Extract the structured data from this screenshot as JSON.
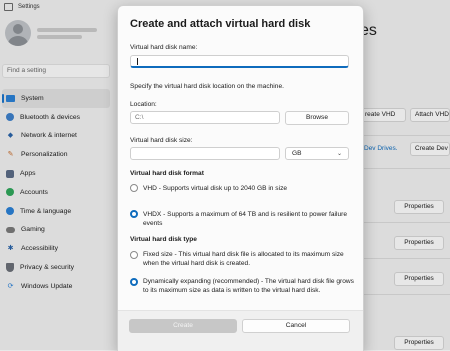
{
  "window": {
    "title": "Settings"
  },
  "sidebar": {
    "search_placeholder": "Find a setting",
    "items": [
      {
        "label": "System",
        "icon": "system-icon",
        "active": true
      },
      {
        "label": "Bluetooth & devices",
        "icon": "bluetooth-icon"
      },
      {
        "label": "Network & internet",
        "icon": "network-icon"
      },
      {
        "label": "Personalization",
        "icon": "personalization-icon"
      },
      {
        "label": "Apps",
        "icon": "apps-icon"
      },
      {
        "label": "Accounts",
        "icon": "accounts-icon"
      },
      {
        "label": "Time & language",
        "icon": "time-language-icon"
      },
      {
        "label": "Gaming",
        "icon": "gaming-icon"
      },
      {
        "label": "Accessibility",
        "icon": "accessibility-icon"
      },
      {
        "label": "Privacy & security",
        "icon": "privacy-icon"
      },
      {
        "label": "Windows Update",
        "icon": "windows-update-icon"
      }
    ]
  },
  "background": {
    "heading_fragment": "es",
    "create_vhd": "reate VHD",
    "attach_vhd": "Attach VHD",
    "dev_drives_link": "Dev Drives.",
    "create_dev_drive": "Create Dev D",
    "properties": "Properties"
  },
  "dialog": {
    "title": "Create and attach virtual hard disk",
    "name_label": "Virtual hard disk name:",
    "name_value": "",
    "location_hint": "Specify the virtual hard disk location on the machine.",
    "location_label": "Location:",
    "location_value": "C:\\",
    "browse_label": "Browse",
    "size_label": "Virtual hard disk size:",
    "size_value": "",
    "size_unit": "GB",
    "format_heading": "Virtual hard disk format",
    "format_vhd": "VHD - Supports virtual disk up to 2040 GB in size",
    "format_vhdx": "VHDX - Supports a maximum of 64 TB and is resilient to power failure events",
    "type_heading": "Virtual hard disk type",
    "type_fixed": "Fixed size - This virtual hard disk file is allocated to its maximum size when the virtual hard disk is created.",
    "type_dynamic": "Dynamically expanding (recommended) - The virtual hard disk file grows to its maximum size as data is written to the virtual hard disk.",
    "create_label": "Create",
    "cancel_label": "Cancel"
  },
  "colors": {
    "accent": "#0f6cbd"
  }
}
